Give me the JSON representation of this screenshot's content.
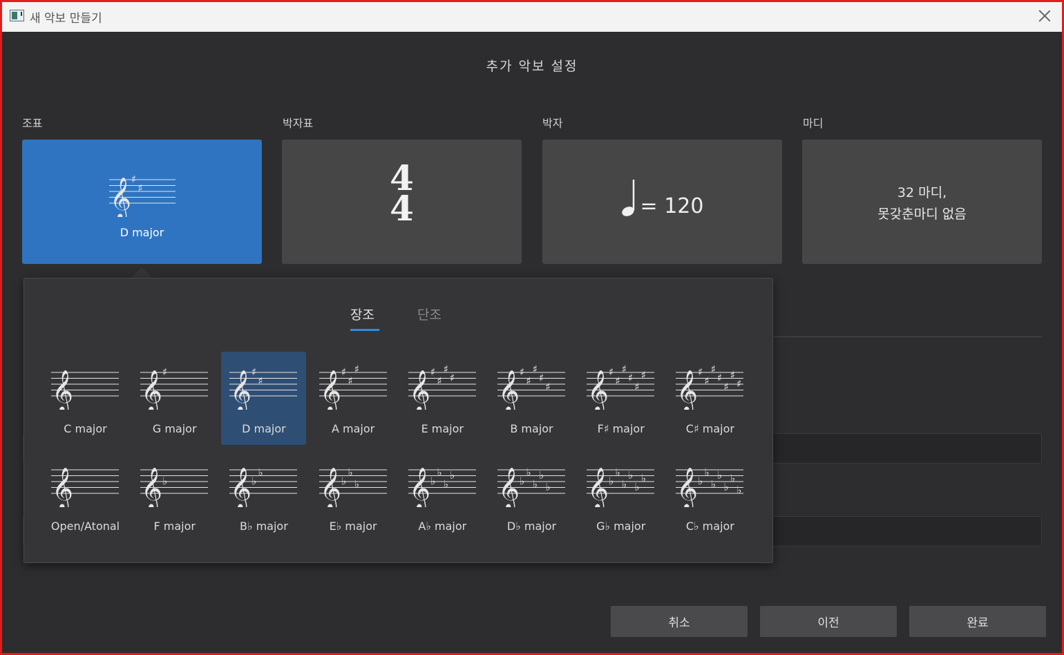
{
  "window": {
    "title": "새 악보 만들기"
  },
  "heading": "추가 악보 설정",
  "sections": {
    "key": {
      "label": "조표",
      "value": "D major"
    },
    "time": {
      "label": "박자표",
      "top": "4",
      "bottom": "4"
    },
    "tempo": {
      "label": "박자",
      "value": "= 120"
    },
    "bars": {
      "label": "마디",
      "line1": "32 마디,",
      "line2": "못갖춘마디 없음"
    }
  },
  "popup": {
    "tabs": [
      {
        "label": "장조",
        "selected": true
      },
      {
        "label": "단조",
        "selected": false
      }
    ],
    "keys_row1": [
      {
        "label": "C major",
        "type": "sharp",
        "count": 0
      },
      {
        "label": "G major",
        "type": "sharp",
        "count": 1
      },
      {
        "label": "D major",
        "type": "sharp",
        "count": 2,
        "selected": true
      },
      {
        "label": "A major",
        "type": "sharp",
        "count": 3
      },
      {
        "label": "E major",
        "type": "sharp",
        "count": 4
      },
      {
        "label": "B major",
        "type": "sharp",
        "count": 5
      },
      {
        "label": "F♯ major",
        "type": "sharp",
        "count": 6
      },
      {
        "label": "C♯ major",
        "type": "sharp",
        "count": 7
      }
    ],
    "keys_row2": [
      {
        "label": "Open/Atonal",
        "type": "flat",
        "count": 0
      },
      {
        "label": "F major",
        "type": "flat",
        "count": 1
      },
      {
        "label": "B♭ major",
        "type": "flat",
        "count": 2
      },
      {
        "label": "E♭ major",
        "type": "flat",
        "count": 3
      },
      {
        "label": "A♭ major",
        "type": "flat",
        "count": 4
      },
      {
        "label": "D♭ major",
        "type": "flat",
        "count": 5
      },
      {
        "label": "G♭ major",
        "type": "flat",
        "count": 6
      },
      {
        "label": "C♭ major",
        "type": "flat",
        "count": 7
      }
    ]
  },
  "buttons": {
    "cancel": "취소",
    "back": "이전",
    "finish": "완료"
  },
  "colors": {
    "accent": "#2f74c0",
    "selected_key_bg": "#2f4e74",
    "tab_underline": "#2f8ae0"
  }
}
